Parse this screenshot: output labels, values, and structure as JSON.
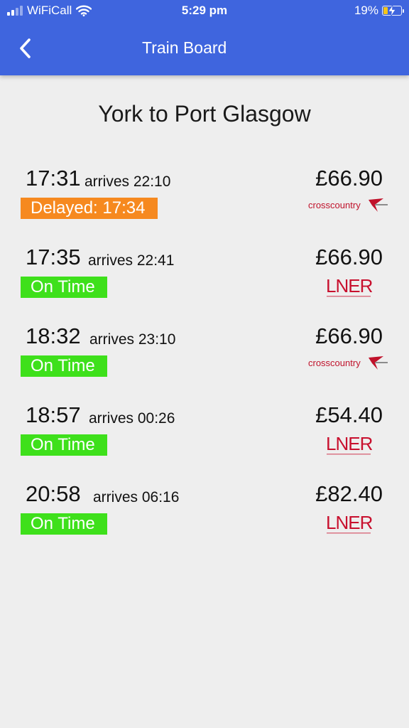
{
  "status_bar": {
    "carrier": "WiFiCall",
    "time": "5:29 pm",
    "battery": "19%"
  },
  "nav": {
    "title": "Train Board",
    "back_icon": "chevron-left-icon"
  },
  "route_title": "York to Port Glasgow",
  "trains": [
    {
      "departs": "17:31",
      "arrives": "arrives 22:10",
      "status": "Delayed: 17:34",
      "status_type": "delayed",
      "price": "£66.90",
      "operator": "crosscountry"
    },
    {
      "departs": "17:35",
      "arrives": "arrives 22:41",
      "status": "On Time",
      "status_type": "on-time",
      "price": "£66.90",
      "operator": "LNER"
    },
    {
      "departs": "18:32",
      "arrives": "arrives 23:10",
      "status": "On Time",
      "status_type": "on-time",
      "price": "£66.90",
      "operator": "crosscountry"
    },
    {
      "departs": "18:57",
      "arrives": "arrives 00:26",
      "status": "On Time",
      "status_type": "on-time",
      "price": "£54.40",
      "operator": "LNER"
    },
    {
      "departs": "20:58",
      "arrives": "arrives 06:16",
      "status": "On Time",
      "status_type": "on-time",
      "price": "£82.40",
      "operator": "LNER"
    }
  ],
  "colors": {
    "header": "#3f65de",
    "on_time": "#3ee01b",
    "delayed": "#f6891f",
    "crosscountry": "#c0122b",
    "lner": "#c8102e"
  }
}
